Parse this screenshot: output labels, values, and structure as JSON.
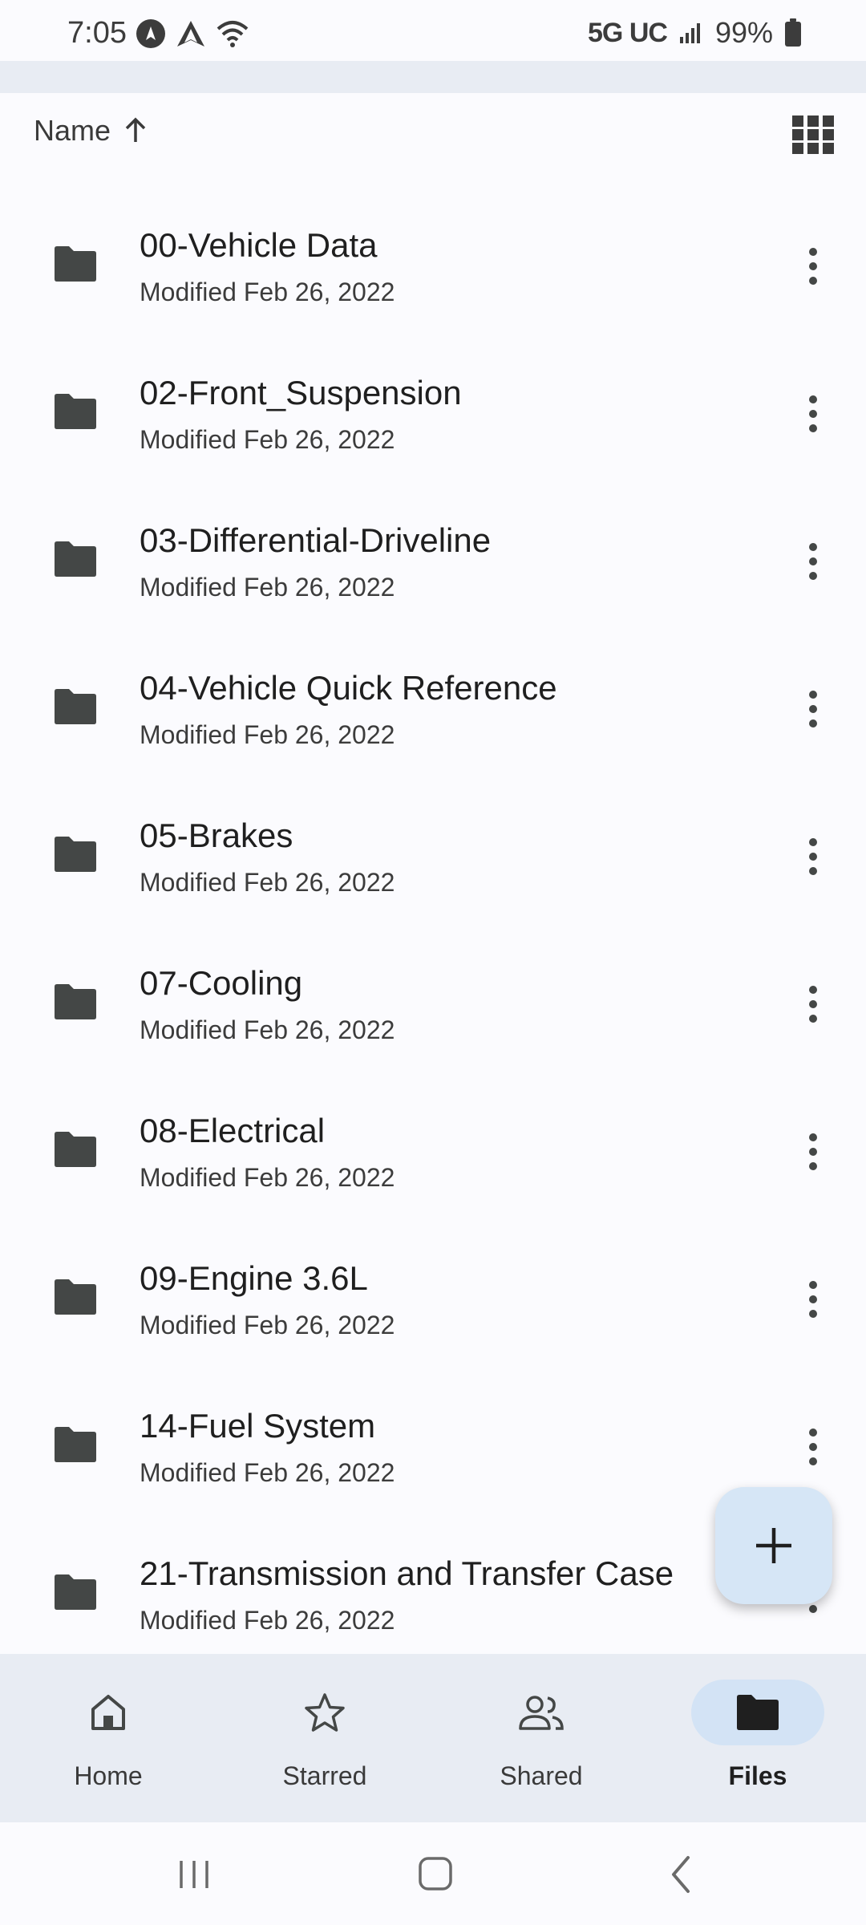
{
  "status_bar": {
    "time": "7:05",
    "network": "5G UC",
    "battery": "99%"
  },
  "sort": {
    "label": "Name",
    "direction_icon": "arrow-up-icon"
  },
  "files": [
    {
      "name": "00-Vehicle Data",
      "meta": "Modified Feb 26, 2022"
    },
    {
      "name": "02-Front_Suspension",
      "meta": "Modified Feb 26, 2022"
    },
    {
      "name": "03-Differential-Driveline",
      "meta": "Modified Feb 26, 2022"
    },
    {
      "name": "04-Vehicle Quick Reference",
      "meta": "Modified Feb 26, 2022"
    },
    {
      "name": "05-Brakes",
      "meta": "Modified Feb 26, 2022"
    },
    {
      "name": "07-Cooling",
      "meta": "Modified Feb 26, 2022"
    },
    {
      "name": "08-Electrical",
      "meta": "Modified Feb 26, 2022"
    },
    {
      "name": "09-Engine 3.6L",
      "meta": "Modified Feb 26, 2022"
    },
    {
      "name": "14-Fuel System",
      "meta": "Modified Feb 26, 2022"
    },
    {
      "name": "21-Transmission and Transfer Case",
      "meta": "Modified Feb 26, 2022"
    }
  ],
  "bottom_nav": [
    {
      "label": "Home",
      "icon": "home-icon",
      "active": false
    },
    {
      "label": "Starred",
      "icon": "star-icon",
      "active": false
    },
    {
      "label": "Shared",
      "icon": "people-icon",
      "active": false
    },
    {
      "label": "Files",
      "icon": "folder-icon",
      "active": true
    }
  ],
  "colors": {
    "background": "#fbfbfe",
    "nav_background": "#e8ecf3",
    "active_pill": "#d3e3f5",
    "fab": "#d6e6f6",
    "icon": "#444746"
  }
}
